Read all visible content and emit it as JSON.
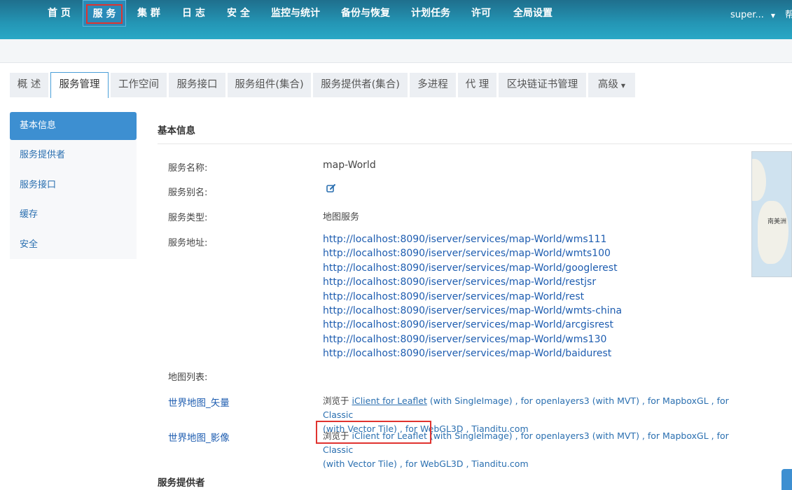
{
  "topnav": {
    "items": [
      "首 页",
      "服 务",
      "集 群",
      "日 志",
      "安 全",
      "监控与统计",
      "备份与恢复",
      "计划任务",
      "许可",
      "全局设置"
    ],
    "active_index": 1,
    "user": "super...",
    "help_partial": "帮"
  },
  "tabs": {
    "items": [
      "概 述",
      "服务管理",
      "工作空间",
      "服务接口",
      "服务组件(集合)",
      "服务提供者(集合)",
      "多进程",
      "代 理",
      "区块链证书管理",
      "高级"
    ],
    "active_index": 1
  },
  "sidemenu": {
    "items": [
      "基本信息",
      "服务提供者",
      "服务接口",
      "缓存",
      "安全"
    ],
    "active_index": 0
  },
  "basic_info": {
    "title": "基本信息",
    "service_name_label": "服务名称:",
    "service_name": "map-World",
    "service_alias_label": "服务别名:",
    "service_type_label": "服务类型:",
    "service_type": "地图服务",
    "service_address_label": "服务地址:",
    "addresses": [
      "http://localhost:8090/iserver/services/map-World/wms111",
      "http://localhost:8090/iserver/services/map-World/wmts100",
      "http://localhost:8090/iserver/services/map-World/googlerest",
      "http://localhost:8090/iserver/services/map-World/restjsr",
      "http://localhost:8090/iserver/services/map-World/rest",
      "http://localhost:8090/iserver/services/map-World/wmts-china",
      "http://localhost:8090/iserver/services/map-World/arcgisrest",
      "http://localhost:8090/iserver/services/map-World/wms130",
      "http://localhost:8090/iserver/services/map-World/baidurest"
    ],
    "map_list_label": "地图列表:",
    "maps": [
      {
        "name": "世界地图_矢量",
        "browse_prefix": "浏览于",
        "leaflet": "iClient for Leaflet",
        "rest_line1": " (with SingleImage) , for openlayers3 (with MVT) , for MapboxGL , for Classic",
        "line2": "(with Vector Tile) , for WebGL3D , Tianditu.com"
      },
      {
        "name": "世界地图_影像",
        "browse_prefix": "浏览于",
        "leaflet": "iClient for Leaflet",
        "rest_line1": " (with SingleImage) , for openlayers3 (with MVT) , for MapboxGL , for Classic",
        "line2": "(with Vector Tile) , for WebGL3D , Tianditu.com"
      }
    ],
    "thumbnail_label": "南美洲"
  },
  "providers_title": "服务提供者",
  "colors": {
    "nav_top": "#1f6f8d",
    "nav_bottom": "#2aa8c6",
    "link": "#1e5db0",
    "active_side": "#3d8fd1",
    "highlight_box": "#e0332f"
  }
}
